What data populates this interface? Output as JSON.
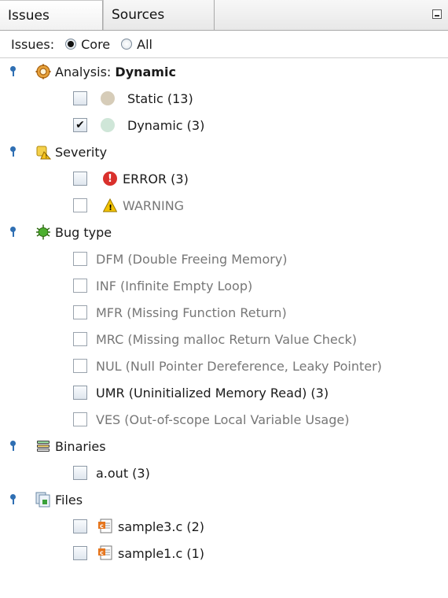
{
  "tabs": [
    {
      "label": "Issues"
    },
    {
      "label": "Sources"
    }
  ],
  "filter": {
    "label": "Issues:",
    "options": [
      {
        "label": "Core",
        "selected": true
      },
      {
        "label": "All",
        "selected": false
      }
    ]
  },
  "analysis": {
    "label_prefix": "Analysis: ",
    "label_value": "Dynamic",
    "items": [
      {
        "label": "Static (13)",
        "checked": false,
        "dot_color": "#d6ccb8"
      },
      {
        "label": "Dynamic (3)",
        "checked": true,
        "dot_color": "#cfe6d8"
      }
    ]
  },
  "severity": {
    "label": "Severity",
    "items": [
      {
        "label": "ERROR (3)",
        "checked": false
      },
      {
        "label": "WARNING",
        "checked": false
      }
    ]
  },
  "bug_type": {
    "label": "Bug type",
    "items": [
      {
        "label": "DFM (Double Freeing Memory)"
      },
      {
        "label": "INF (Infinite Empty Loop)"
      },
      {
        "label": "MFR (Missing Function Return)"
      },
      {
        "label": "MRC (Missing malloc Return Value Check)"
      },
      {
        "label": "NUL (Null Pointer Dereference, Leaky Pointer)"
      },
      {
        "label": "UMR (Uninitialized Memory Read) (3)"
      },
      {
        "label": "VES (Out-of-scope Local Variable Usage)"
      }
    ]
  },
  "binaries": {
    "label": "Binaries",
    "items": [
      {
        "label": "a.out (3)"
      }
    ]
  },
  "files": {
    "label": "Files",
    "items": [
      {
        "label": "sample3.c (2)"
      },
      {
        "label": "sample1.c (1)"
      }
    ]
  },
  "colors": {
    "accent": "#2f6fb3",
    "error": "#d9302c",
    "warning": "#f2c200",
    "bug": "#4caf2e"
  }
}
